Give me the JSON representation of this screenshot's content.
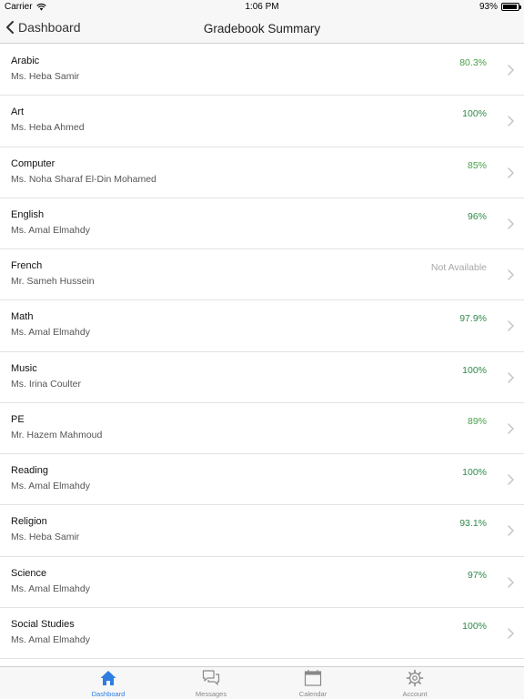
{
  "status_bar": {
    "carrier": "Carrier",
    "time": "1:06 PM",
    "battery": "93%",
    "battery_level": 0.93
  },
  "nav": {
    "back_label": "Dashboard",
    "title": "Gradebook Summary"
  },
  "courses": [
    {
      "subject": "Arabic",
      "teacher": "Ms. Heba Samir",
      "grade": "80.3%",
      "grade_color": "#46a046"
    },
    {
      "subject": "Art",
      "teacher": "Ms. Heba Ahmed",
      "grade": "100%",
      "grade_color": "#2e8a4a"
    },
    {
      "subject": "Computer",
      "teacher": "Ms. Noha Sharaf El-Din Mohamed",
      "grade": "85%",
      "grade_color": "#46a046"
    },
    {
      "subject": "English",
      "teacher": "Ms. Amal Elmahdy",
      "grade": "96%",
      "grade_color": "#2e8a4a"
    },
    {
      "subject": "French",
      "teacher": "Mr. Sameh Hussein",
      "grade": "Not Available",
      "grade_color": "#a7a7a7"
    },
    {
      "subject": "Math",
      "teacher": "Ms. Amal Elmahdy",
      "grade": "97.9%",
      "grade_color": "#2e8a4a"
    },
    {
      "subject": "Music",
      "teacher": "Ms. Irina Coulter",
      "grade": "100%",
      "grade_color": "#2e8a4a"
    },
    {
      "subject": "PE",
      "teacher": "Mr. Hazem Mahmoud",
      "grade": "89%",
      "grade_color": "#46a046"
    },
    {
      "subject": "Reading",
      "teacher": "Ms. Amal Elmahdy",
      "grade": "100%",
      "grade_color": "#2e8a4a"
    },
    {
      "subject": "Religion",
      "teacher": "Ms. Heba Samir",
      "grade": "93.1%",
      "grade_color": "#2e8a4a"
    },
    {
      "subject": "Science",
      "teacher": "Ms. Amal Elmahdy",
      "grade": "97%",
      "grade_color": "#2e8a4a"
    },
    {
      "subject": "Social Studies",
      "teacher": "Ms. Amal Elmahdy",
      "grade": "100%",
      "grade_color": "#2e8a4a"
    }
  ],
  "tabs": [
    {
      "label": "Dashboard",
      "icon": "home-icon",
      "active": true
    },
    {
      "label": "Messages",
      "icon": "messages-icon",
      "active": false
    },
    {
      "label": "Calendar",
      "icon": "calendar-icon",
      "active": false
    },
    {
      "label": "Account",
      "icon": "gear-icon",
      "active": false
    }
  ],
  "colors": {
    "accent": "#2f7de1",
    "grade_high": "#2e8a4a",
    "grade_mid": "#46a046",
    "not_available": "#a7a7a7"
  }
}
